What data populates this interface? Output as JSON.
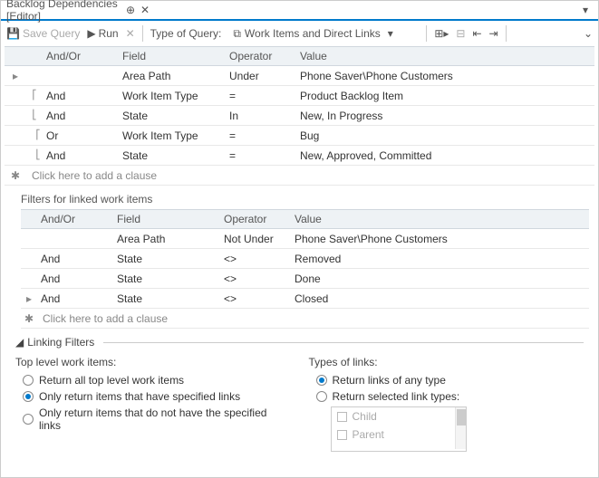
{
  "titlebar": {
    "title": "Backlog Dependencies [Editor]"
  },
  "toolbar": {
    "save": "Save Query",
    "run": "Run",
    "type_label": "Type of Query:",
    "type_value": "Work Items and Direct Links"
  },
  "grid1": {
    "headers": {
      "andor": "And/Or",
      "field": "Field",
      "op": "Operator",
      "value": "Value"
    },
    "rows": [
      {
        "andor": "",
        "field": "Area Path",
        "op": "Under",
        "value": "Phone Saver\\Phone Customers"
      },
      {
        "andor": "And",
        "field": "Work Item Type",
        "op": "=",
        "value": "Product Backlog Item"
      },
      {
        "andor": "And",
        "field": "State",
        "op": "In",
        "value": "New, In Progress"
      },
      {
        "andor": "Or",
        "field": "Work Item Type",
        "op": "=",
        "value": "Bug"
      },
      {
        "andor": "And",
        "field": "State",
        "op": "=",
        "value": "New, Approved, Committed"
      }
    ],
    "placeholder": "Click here to add a clause"
  },
  "section2_label": "Filters for linked work items",
  "grid2": {
    "headers": {
      "andor": "And/Or",
      "field": "Field",
      "op": "Operator",
      "value": "Value"
    },
    "rows": [
      {
        "andor": "",
        "field": "Area Path",
        "op": "Not Under",
        "value": "Phone Saver\\Phone Customers"
      },
      {
        "andor": "And",
        "field": "State",
        "op": "<>",
        "value": "Removed"
      },
      {
        "andor": "And",
        "field": "State",
        "op": "<>",
        "value": "Done"
      },
      {
        "andor": "And",
        "field": "State",
        "op": "<>",
        "value": "Closed"
      }
    ],
    "placeholder": "Click here to add a clause"
  },
  "linking": {
    "header": "Linking Filters",
    "top_label": "Top level work items:",
    "top_opts": [
      "Return all top level work items",
      "Only return items that have specified links",
      "Only return items that do not have the specified links"
    ],
    "types_label": "Types of links:",
    "types_opts": [
      "Return links of any type",
      "Return selected link types:"
    ],
    "link_types": [
      "Child",
      "Parent"
    ]
  }
}
